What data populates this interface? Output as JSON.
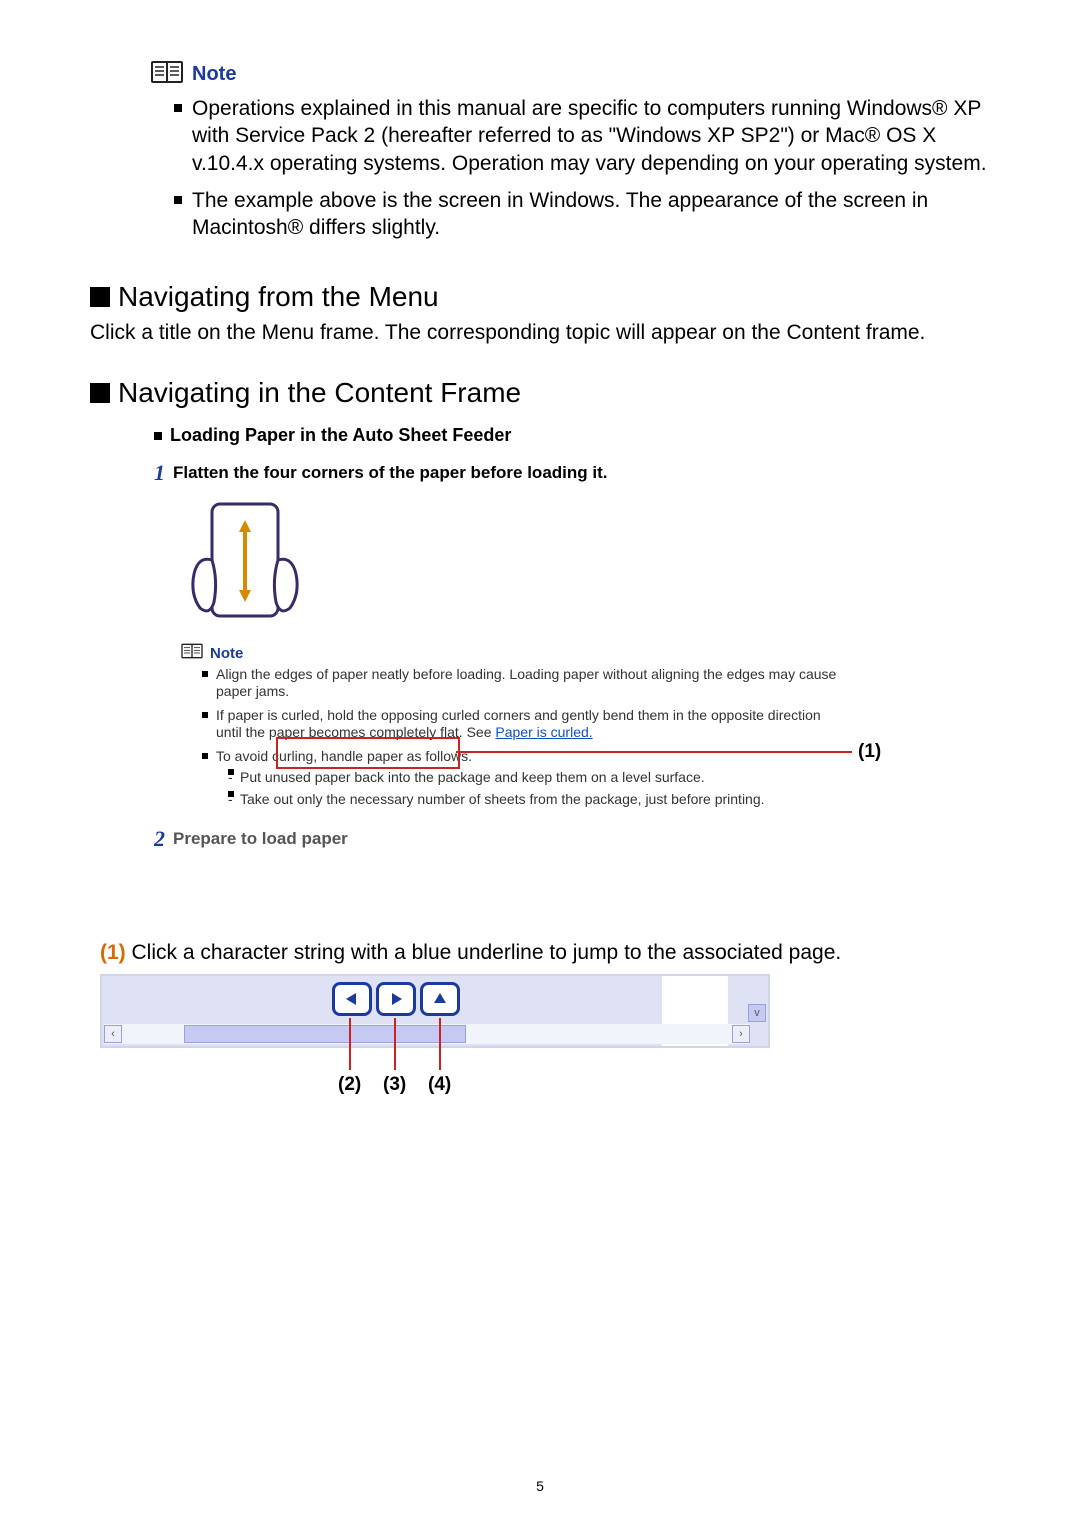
{
  "note": {
    "label": "Note",
    "bullets": [
      "Operations explained in this manual are specific to computers running Windows® XP with Service Pack 2 (hereafter referred to as \"Windows XP SP2\") or Mac® OS X v.10.4.x operating systems. Operation may vary depending on your operating system.",
      "The example above is the screen in Windows. The appearance of the screen in Macintosh® differs slightly."
    ]
  },
  "section1": {
    "title": "Navigating from the Menu",
    "body": "Click a title on the Menu frame. The corresponding topic will appear on the Content frame."
  },
  "section2": {
    "title": "Navigating in the Content Frame",
    "content_title": "Loading Paper in the Auto Sheet Feeder",
    "step1_num": "1",
    "step1_text": "Flatten the four corners of the paper before loading it.",
    "inner_note_label": "Note",
    "inner_bullets": [
      "Align the edges of paper neatly before loading. Loading paper without aligning the edges may cause paper jams.",
      "If paper is curled, hold the opposing curled corners and gently bend them in the opposite direction until the paper becomes completely flat. See ",
      "To avoid curling, handle paper as follows."
    ],
    "link_text": "Paper is curled.",
    "inner_sub": [
      "Put unused paper back into the package and keep them on a level surface.",
      "Take out only the necessary number of sheets from the package, just before printing."
    ],
    "step2_num": "2",
    "step2_text": "Prepare to load paper",
    "callout1": "(1)",
    "caption_prefix": "(1)",
    "caption_body": " Click a character string with a blue underline to jump to the associated page.",
    "callouts_bottom": {
      "c2": "(2)",
      "c3": "(3)",
      "c4": "(4)"
    }
  },
  "page_number": "5"
}
